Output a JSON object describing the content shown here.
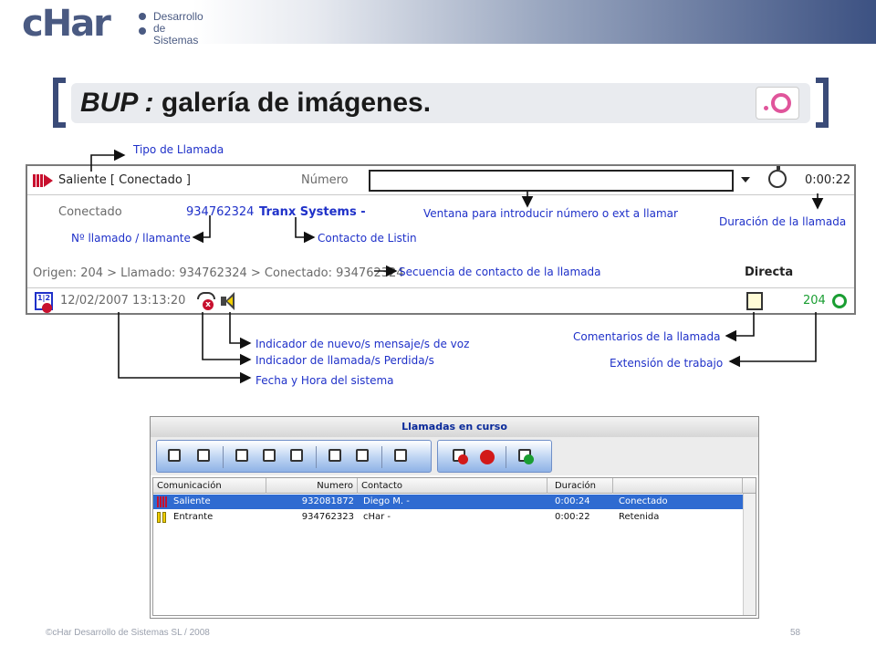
{
  "header": {
    "logo_main": "cHar",
    "logo_sub_1": "Desarrollo",
    "logo_sub_2": "de Sistemas",
    "title_prefix": "BUP :",
    "title_rest": " galería de imágenes."
  },
  "panel": {
    "call_type": "Saliente [ Conectado ]",
    "number_label": "Número",
    "duration": "0:00:22",
    "connected_label": "Conectado",
    "connected_number": "934762324",
    "contact": "Tranx Systems -",
    "sequence": "Origen: 204 > Llamado: 934762324 > Conectado: 934762324",
    "mode": "Directa",
    "datetime": "12/02/2007   13:13:20",
    "extension": "204"
  },
  "annotations": {
    "tipo_llamada": "Tipo de Llamada",
    "ventana": "Ventana para introducir número o ext a llamar",
    "duracion": "Duración de la llamada",
    "n_llamado": "Nº llamado / llamante",
    "contacto": "Contacto de Listin",
    "secuencia": "Secuencia de contacto de la llamada",
    "comentarios": "Comentarios de la llamada",
    "extension": "Extensión de trabajo",
    "nuevo_mensaje": "Indicador de nuevo/s mensaje/s de voz",
    "perdida": "Indicador de llamada/s Perdida/s",
    "fecha": "Fecha y Hora del sistema"
  },
  "window": {
    "title": "Llamadas en curso",
    "columns": [
      "Comunicación",
      "Numero",
      "Contacto",
      "Duración",
      ""
    ],
    "rows": [
      {
        "tipo": "Saliente",
        "numero": "932081872",
        "contacto": "Diego M. -",
        "duracion": "0:00:24",
        "estado": "Conectado",
        "selected": true
      },
      {
        "tipo": "Entrante",
        "numero": "934762323",
        "contacto": "cHar -",
        "duracion": "0:00:22",
        "estado": "Retenida",
        "selected": false
      }
    ]
  },
  "footer": {
    "copyright": "©cHar Desarrollo de Sistemas SL / 2008",
    "page": "58"
  },
  "colors": {
    "annotation": "#1f31c9",
    "selection": "#2f6bd1",
    "accent_red": "#c8102e"
  }
}
